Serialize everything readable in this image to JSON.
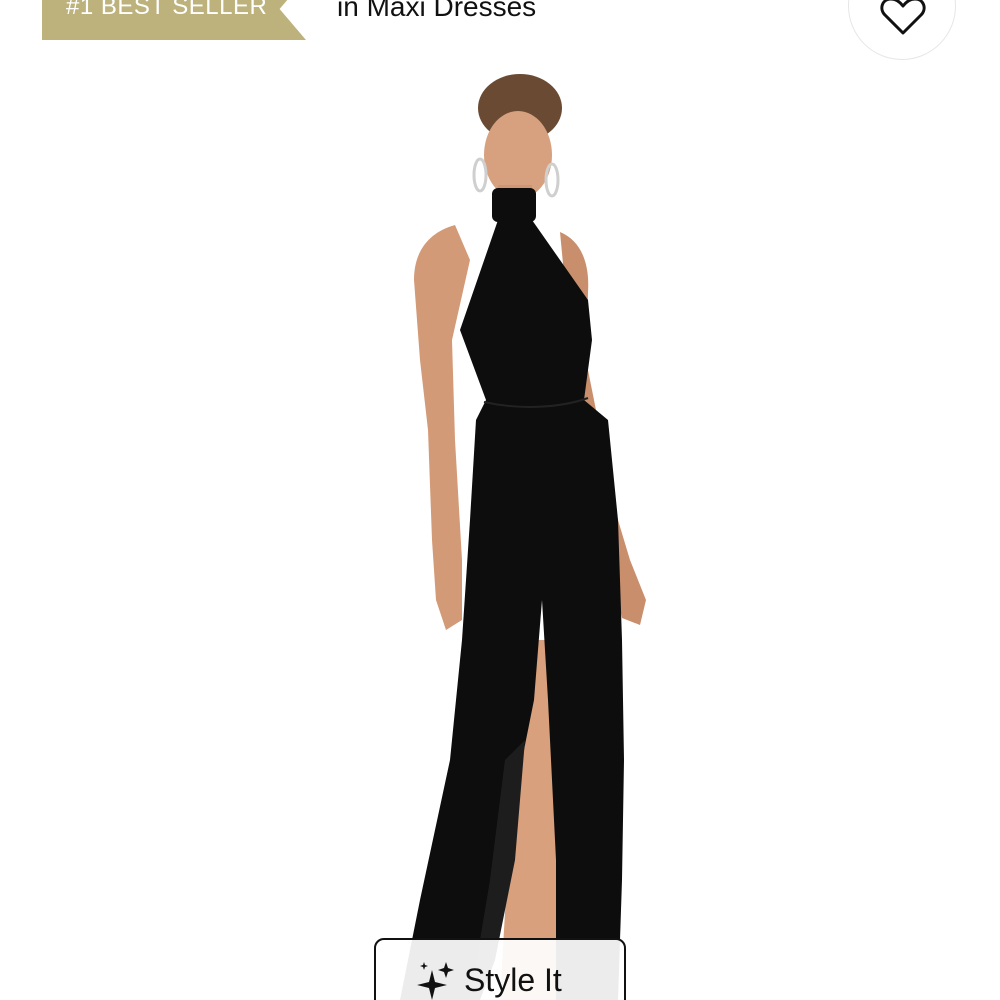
{
  "badge": {
    "label": "#1 BEST SELLER",
    "color": "#bdb27c"
  },
  "category": {
    "text": "in Maxi Dresses"
  },
  "wishlist": {
    "icon": "heart-icon"
  },
  "product": {
    "image_alt": "black halter maxi dress with thigh-high slit",
    "dress_color": "#0d0d0d"
  },
  "style_it": {
    "label": "Style It",
    "icon": "sparkles-icon"
  }
}
